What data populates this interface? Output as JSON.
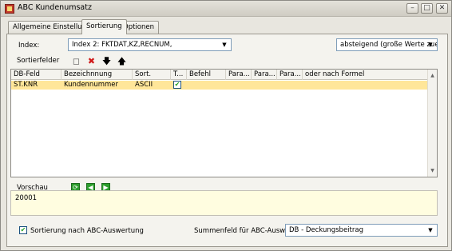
{
  "window": {
    "title": "ABC Kundenumsatz"
  },
  "tabs": [
    {
      "label": "Allgemeine Einstellungen"
    },
    {
      "label": "Sortierung"
    },
    {
      "label": "Optionen"
    }
  ],
  "index": {
    "label": "Index:",
    "value": "Index 2: FKTDAT,KZ,RECNUM,",
    "order_value": "absteigend (große Werte zuerst)"
  },
  "sortfields": {
    "label": "Sortierfelder",
    "columns": [
      "DB-Feld",
      "Bezeichnnung",
      "Sort.",
      "T...",
      "Befehl",
      "Para...",
      "Para...",
      "Para...",
      "oder nach Formel"
    ],
    "rows": [
      {
        "db_field": "ST.KNR",
        "bezeichnung": "Kundennummer",
        "sort": "ASCII",
        "t_checked": true,
        "befehl": "",
        "p1": "",
        "p2": "",
        "p3": "",
        "formel": ""
      }
    ]
  },
  "preview": {
    "label": "Vorschau",
    "value": "20001"
  },
  "bottom": {
    "abc_sort_label": "Sortierung nach ABC-Auswertung",
    "abc_sort_checked": true,
    "sum_label": "Summenfeld für ABC-Auswertung",
    "sum_value": "DB - Deckungsbeitrag"
  },
  "colors": {
    "selected_row": "#ffe699",
    "accent": "#2e9f2e"
  }
}
